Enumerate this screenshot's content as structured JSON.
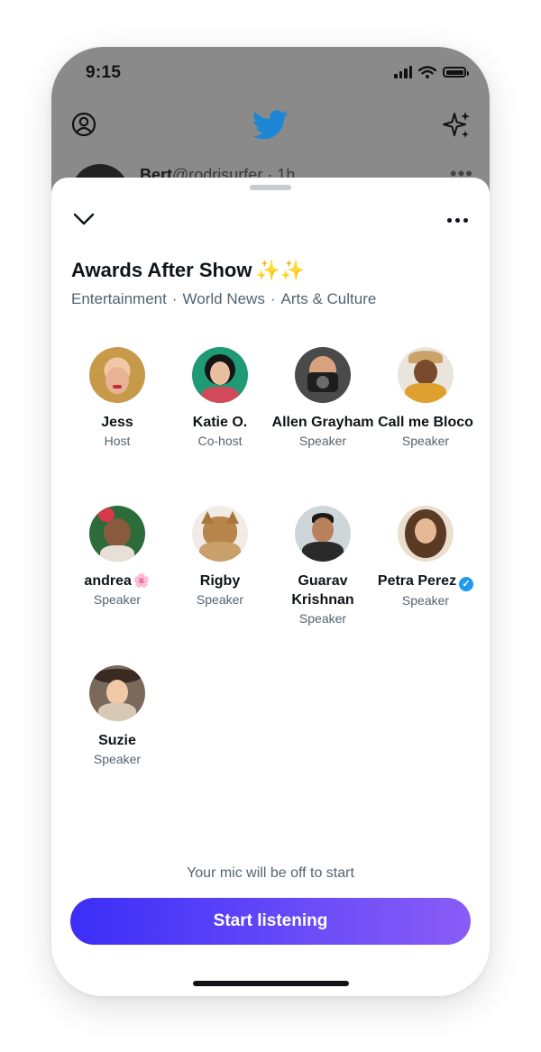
{
  "status_bar": {
    "time": "9:15"
  },
  "timeline": {
    "tweet_name": "Bert",
    "tweet_handle_time": "@rodrisurfer · 1h"
  },
  "space": {
    "title": "Awards After Show",
    "title_emoji": "✨✨",
    "topics": [
      "Entertainment",
      "World News",
      "Arts & Culture"
    ],
    "topic_separator": "·"
  },
  "participants": [
    {
      "name": "Jess",
      "role": "Host"
    },
    {
      "name": "Katie O.",
      "role": "Co-host"
    },
    {
      "name": "Allen Grayham",
      "role": "Speaker"
    },
    {
      "name": "Call me Bloco",
      "role": "Speaker"
    },
    {
      "name": "andrea",
      "name_emoji": "🌸",
      "role": "Speaker"
    },
    {
      "name": "Rigby",
      "role": "Speaker"
    },
    {
      "name": "Guarav Krishnan",
      "role": "Speaker"
    },
    {
      "name": "Petra Perez",
      "verified": true,
      "role": "Speaker"
    },
    {
      "name": "Suzie",
      "role": "Speaker"
    }
  ],
  "footer": {
    "mic_note": "Your mic will be off to start",
    "cta_label": "Start listening"
  },
  "colors": {
    "twitter_blue": "#1d9bf0",
    "cta_gradient_start": "#3b2ef7",
    "cta_gradient_end": "#8a5cf6",
    "text_primary": "#0f1419",
    "text_secondary": "#536471"
  },
  "icons": [
    "profile-icon",
    "twitter-bird-icon",
    "sparkle-icon",
    "chevron-down-icon",
    "more-icon",
    "verified-icon"
  ]
}
